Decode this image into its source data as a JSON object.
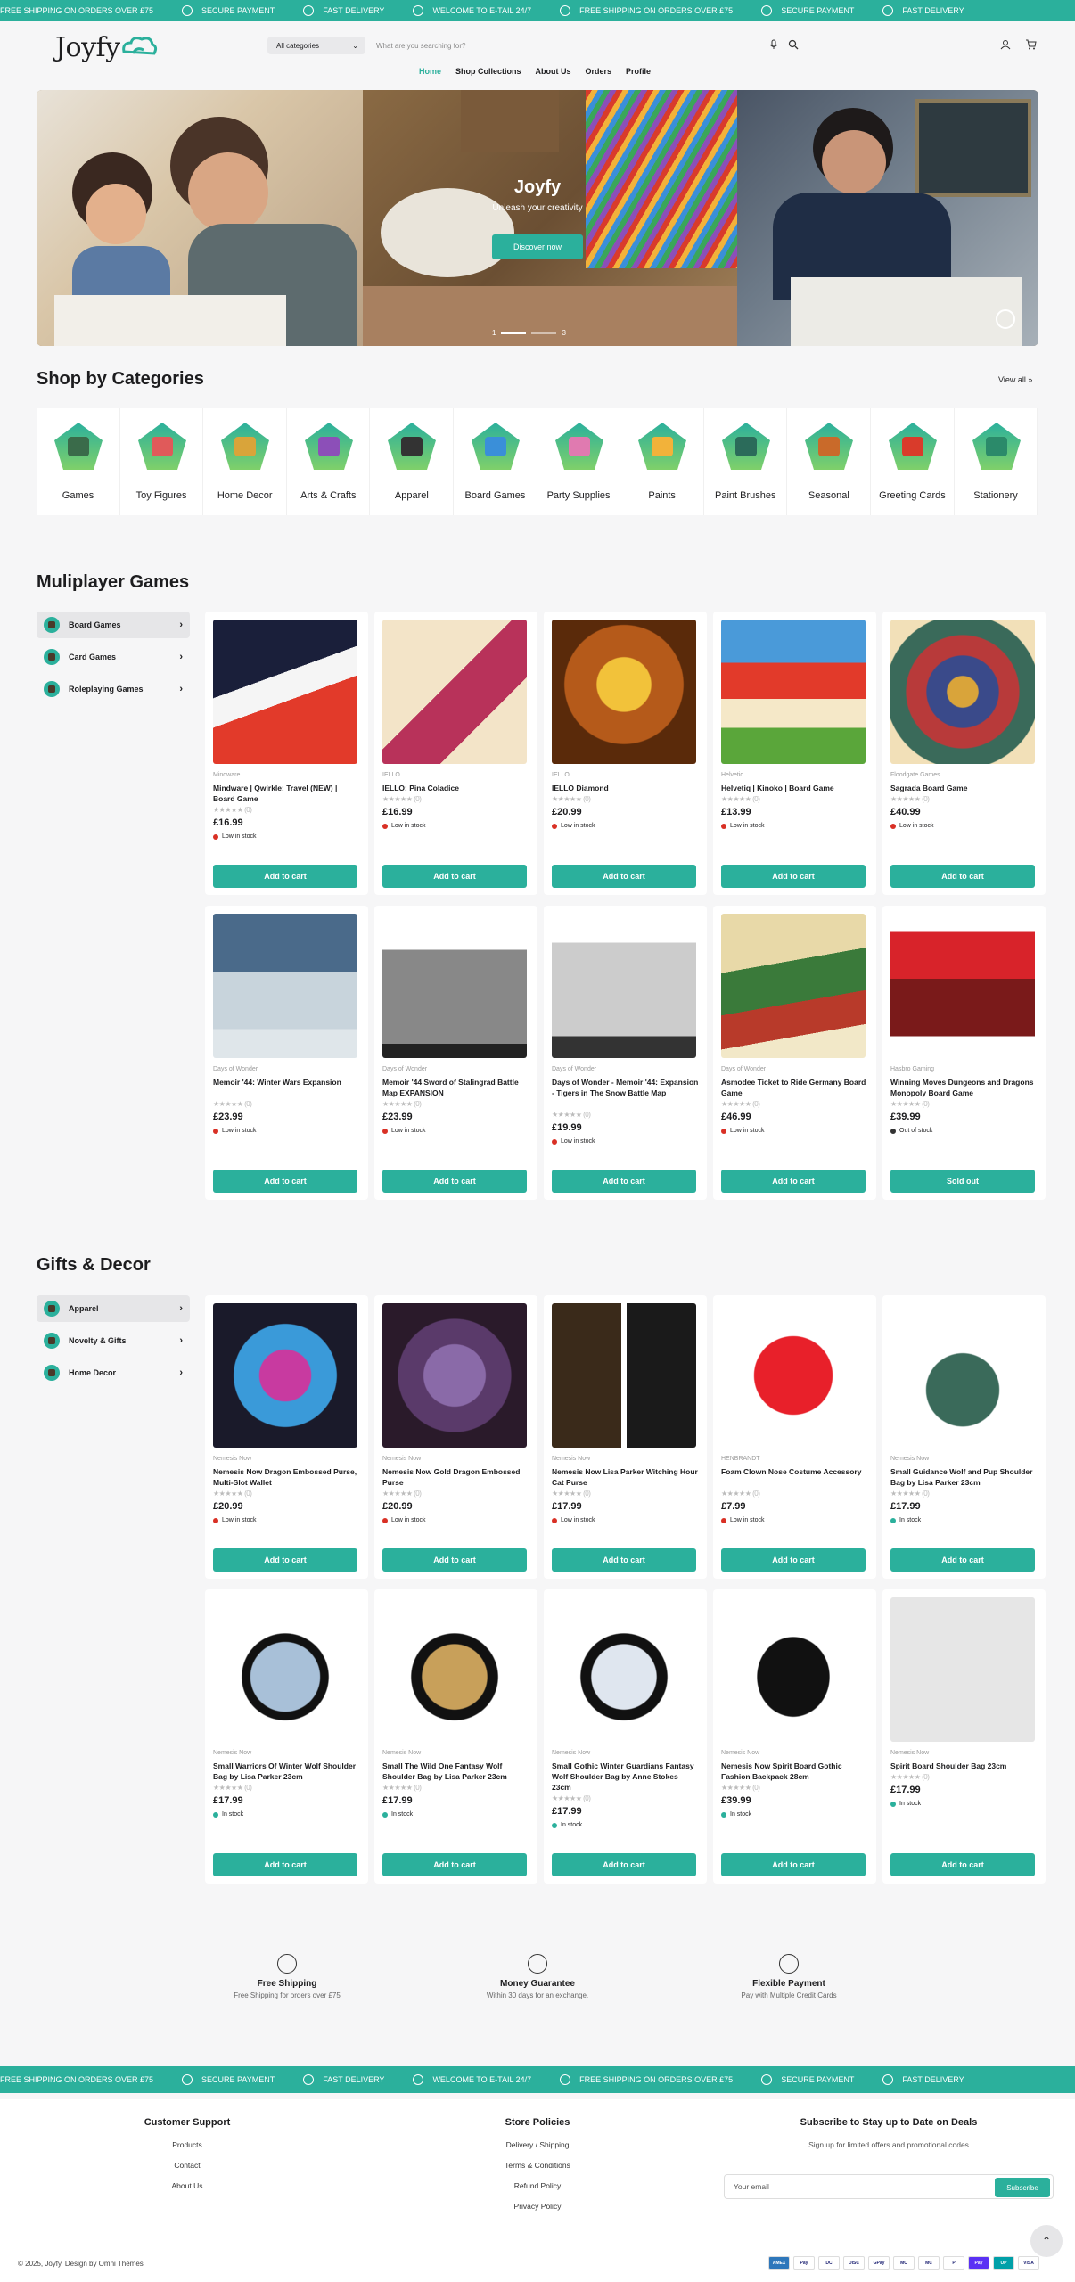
{
  "ticker": [
    "FREE SHIPPING ON ORDERS OVER £75",
    "SECURE PAYMENT",
    "FAST DELIVERY",
    "WELCOME TO E-TAIL 24/7",
    "FREE SHIPPING ON ORDERS OVER £75",
    "SECURE PAYMENT",
    "FAST DELIVERY"
  ],
  "header": {
    "logo": "Joyfy",
    "category_select": "All categories",
    "search_placeholder": "What are you searching for?",
    "nav": [
      "Home",
      "Shop Collections",
      "About Us",
      "Orders",
      "Profile"
    ]
  },
  "hero": {
    "title": "Joyfy",
    "subtitle": "Unleash your creativity",
    "button": "Discover now",
    "slide_start": "1",
    "slide_end": "3"
  },
  "categories_section": {
    "title": "Shop by Categories",
    "view_all": "View all",
    "items": [
      "Games",
      "Toy Figures",
      "Home Decor",
      "Arts & Crafts",
      "Apparel",
      "Board Games",
      "Party Supplies",
      "Paints",
      "Paint Brushes",
      "Seasonal",
      "Greeting Cards",
      "Stationery"
    ]
  },
  "multiplayer": {
    "title": "Muliplayer Games",
    "sidebar": [
      "Board Games",
      "Card Games",
      "Roleplaying Games"
    ],
    "products": [
      {
        "brand": "Mindware",
        "name": "Mindware | Qwirkle: Travel (NEW) | Board Game",
        "reviews": "(0)",
        "price": "£16.99",
        "stock": "Low in stock",
        "button": "Add to cart"
      },
      {
        "brand": "IELLO",
        "name": "IELLO: Pina Coladice",
        "reviews": "(0)",
        "price": "£16.99",
        "stock": "Low in stock",
        "button": "Add to cart"
      },
      {
        "brand": "IELLO",
        "name": "IELLO Diamond",
        "reviews": "(0)",
        "price": "£20.99",
        "stock": "Low in stock",
        "button": "Add to cart"
      },
      {
        "brand": "Helvetiq",
        "name": "Helvetiq | Kinoko | Board Game",
        "reviews": "(0)",
        "price": "£13.99",
        "stock": "Low in stock",
        "button": "Add to cart"
      },
      {
        "brand": "Floodgate Games",
        "name": "Sagrada Board Game",
        "reviews": "(0)",
        "price": "£40.99",
        "stock": "Low in stock",
        "button": "Add to cart"
      },
      {
        "brand": "Days of Wonder",
        "name": "Memoir '44: Winter Wars Expansion",
        "reviews": "(0)",
        "price": "£23.99",
        "stock": "Low in stock",
        "button": "Add to cart"
      },
      {
        "brand": "Days of Wonder",
        "name": "Memoir '44 Sword of Stalingrad Battle Map EXPANSION",
        "reviews": "(0)",
        "price": "£23.99",
        "stock": "Low in stock",
        "button": "Add to cart"
      },
      {
        "brand": "Days of Wonder",
        "name": "Days of Wonder - Memoir '44: Expansion - Tigers in The Snow Battle Map",
        "reviews": "(0)",
        "price": "£19.99",
        "stock": "Low in stock",
        "button": "Add to cart"
      },
      {
        "brand": "Days of Wonder",
        "name": "Asmodee Ticket to Ride Germany Board Game",
        "reviews": "(0)",
        "price": "£46.99",
        "stock": "Low in stock",
        "button": "Add to cart"
      },
      {
        "brand": "Hasbro Gaming",
        "name": "Winning Moves Dungeons and Dragons Monopoly Board Game",
        "reviews": "(0)",
        "price": "£39.99",
        "stock": "Out of stock",
        "button": "Sold out"
      }
    ]
  },
  "gifts": {
    "title": "Gifts & Decor",
    "sidebar": [
      "Apparel",
      "Novelty & Gifts",
      "Home Decor"
    ],
    "products": [
      {
        "brand": "Nemesis Now",
        "name": "Nemesis Now Dragon Embossed Purse, Multi-Slot Wallet",
        "reviews": "(0)",
        "price": "£20.99",
        "stock": "Low in stock",
        "button": "Add to cart"
      },
      {
        "brand": "Nemesis Now",
        "name": "Nemesis Now Gold Dragon Embossed Purse",
        "reviews": "(0)",
        "price": "£20.99",
        "stock": "Low in stock",
        "button": "Add to cart"
      },
      {
        "brand": "Nemesis Now",
        "name": "Nemesis Now Lisa Parker Witching Hour Cat Purse",
        "reviews": "(0)",
        "price": "£17.99",
        "stock": "Low in stock",
        "button": "Add to cart"
      },
      {
        "brand": "HENBRANDT",
        "name": "Foam Clown Nose Costume Accessory",
        "reviews": "(0)",
        "price": "£7.99",
        "stock": "Low in stock",
        "button": "Add to cart"
      },
      {
        "brand": "Nemesis Now",
        "name": "Small Guidance Wolf and Pup Shoulder Bag by Lisa Parker 23cm",
        "reviews": "(0)",
        "price": "£17.99",
        "stock": "In stock",
        "button": "Add to cart"
      },
      {
        "brand": "Nemesis Now",
        "name": "Small Warriors Of Winter Wolf Shoulder Bag by Lisa Parker 23cm",
        "reviews": "(0)",
        "price": "£17.99",
        "stock": "In stock",
        "button": "Add to cart"
      },
      {
        "brand": "Nemesis Now",
        "name": "Small The Wild One Fantasy Wolf Shoulder Bag by Lisa Parker 23cm",
        "reviews": "(0)",
        "price": "£17.99",
        "stock": "In stock",
        "button": "Add to cart"
      },
      {
        "brand": "Nemesis Now",
        "name": "Small Gothic Winter Guardians Fantasy Wolf Shoulder Bag by Anne Stokes 23cm",
        "reviews": "(0)",
        "price": "£17.99",
        "stock": "In stock",
        "button": "Add to cart"
      },
      {
        "brand": "Nemesis Now",
        "name": "Nemesis Now Spirit Board Gothic Fashion Backpack 28cm",
        "reviews": "(0)",
        "price": "£39.99",
        "stock": "In stock",
        "button": "Add to cart"
      },
      {
        "brand": "Nemesis Now",
        "name": "Spirit Board Shoulder Bag 23cm",
        "reviews": "(0)",
        "price": "£17.99",
        "stock": "In stock",
        "button": "Add to cart"
      }
    ]
  },
  "features": [
    {
      "title": "Free Shipping",
      "desc": "Free Shipping for orders over £75"
    },
    {
      "title": "Money Guarantee",
      "desc": "Within 30 days for an exchange."
    },
    {
      "title": "Flexible Payment",
      "desc": "Pay with Multiple Credit Cards"
    }
  ],
  "footer": {
    "support_title": "Customer Support",
    "support_links": [
      "Products",
      "Contact",
      "About Us"
    ],
    "policies_title": "Store Policies",
    "policies_links": [
      "Delivery / Shipping",
      "Terms & Conditions",
      "Refund Policy",
      "Privacy Policy"
    ],
    "newsletter_title": "Subscribe to Stay up to Date on Deals",
    "newsletter_desc": "Sign up for limited offers and promotional codes",
    "email_placeholder": "Your email",
    "subscribe": "Subscribe",
    "copyright": "© 2025, Joyfy, Design by Omni Themes",
    "payments": [
      "AMEX",
      "Pay",
      "DC",
      "DISC",
      "GPay",
      "MC",
      "MC",
      "P",
      "Pay",
      "UP",
      "VISA"
    ]
  },
  "colors": {
    "accent": "#2bb09c",
    "low_stock": "#d93025",
    "in_stock": "#2bb09c",
    "out_stock": "#333333"
  }
}
